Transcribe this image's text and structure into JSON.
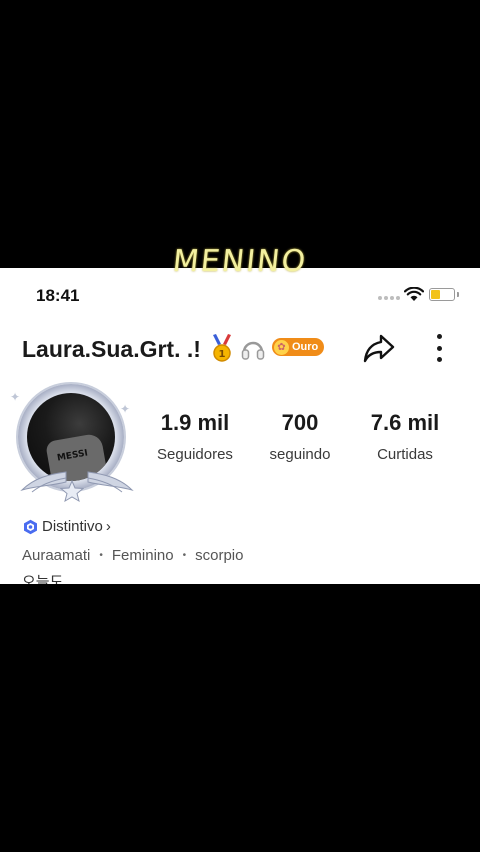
{
  "overlay": {
    "caption": "MENINO"
  },
  "status_bar": {
    "time": "18:41",
    "battery_level": 0.45,
    "battery_color": "#f2c21b"
  },
  "profile": {
    "username": "Laura.Sua.Grt. .!",
    "gold_badge_label": "Ouro",
    "icons": [
      "medal-icon",
      "headphones-icon",
      "gold-badge-icon",
      "share-icon",
      "more-icon"
    ]
  },
  "stats": [
    {
      "value": "1.9 mil",
      "label": "Seguidores"
    },
    {
      "value": "700",
      "label": "seguindo"
    },
    {
      "value": "7.6 mil",
      "label": "Curtidas"
    }
  ],
  "avatar": {
    "shirt_text": "MESSI"
  },
  "badge_link": {
    "label": "Distintivo",
    "chevron": "›"
  },
  "tags": [
    "Auraamati",
    "Feminino",
    "scorpio"
  ],
  "tag_separator": "•",
  "bio": {
    "partial": "오늘도"
  },
  "colors": {
    "accent_orange": "#f08c18",
    "distintivo_blue": "#4a6cf0"
  }
}
